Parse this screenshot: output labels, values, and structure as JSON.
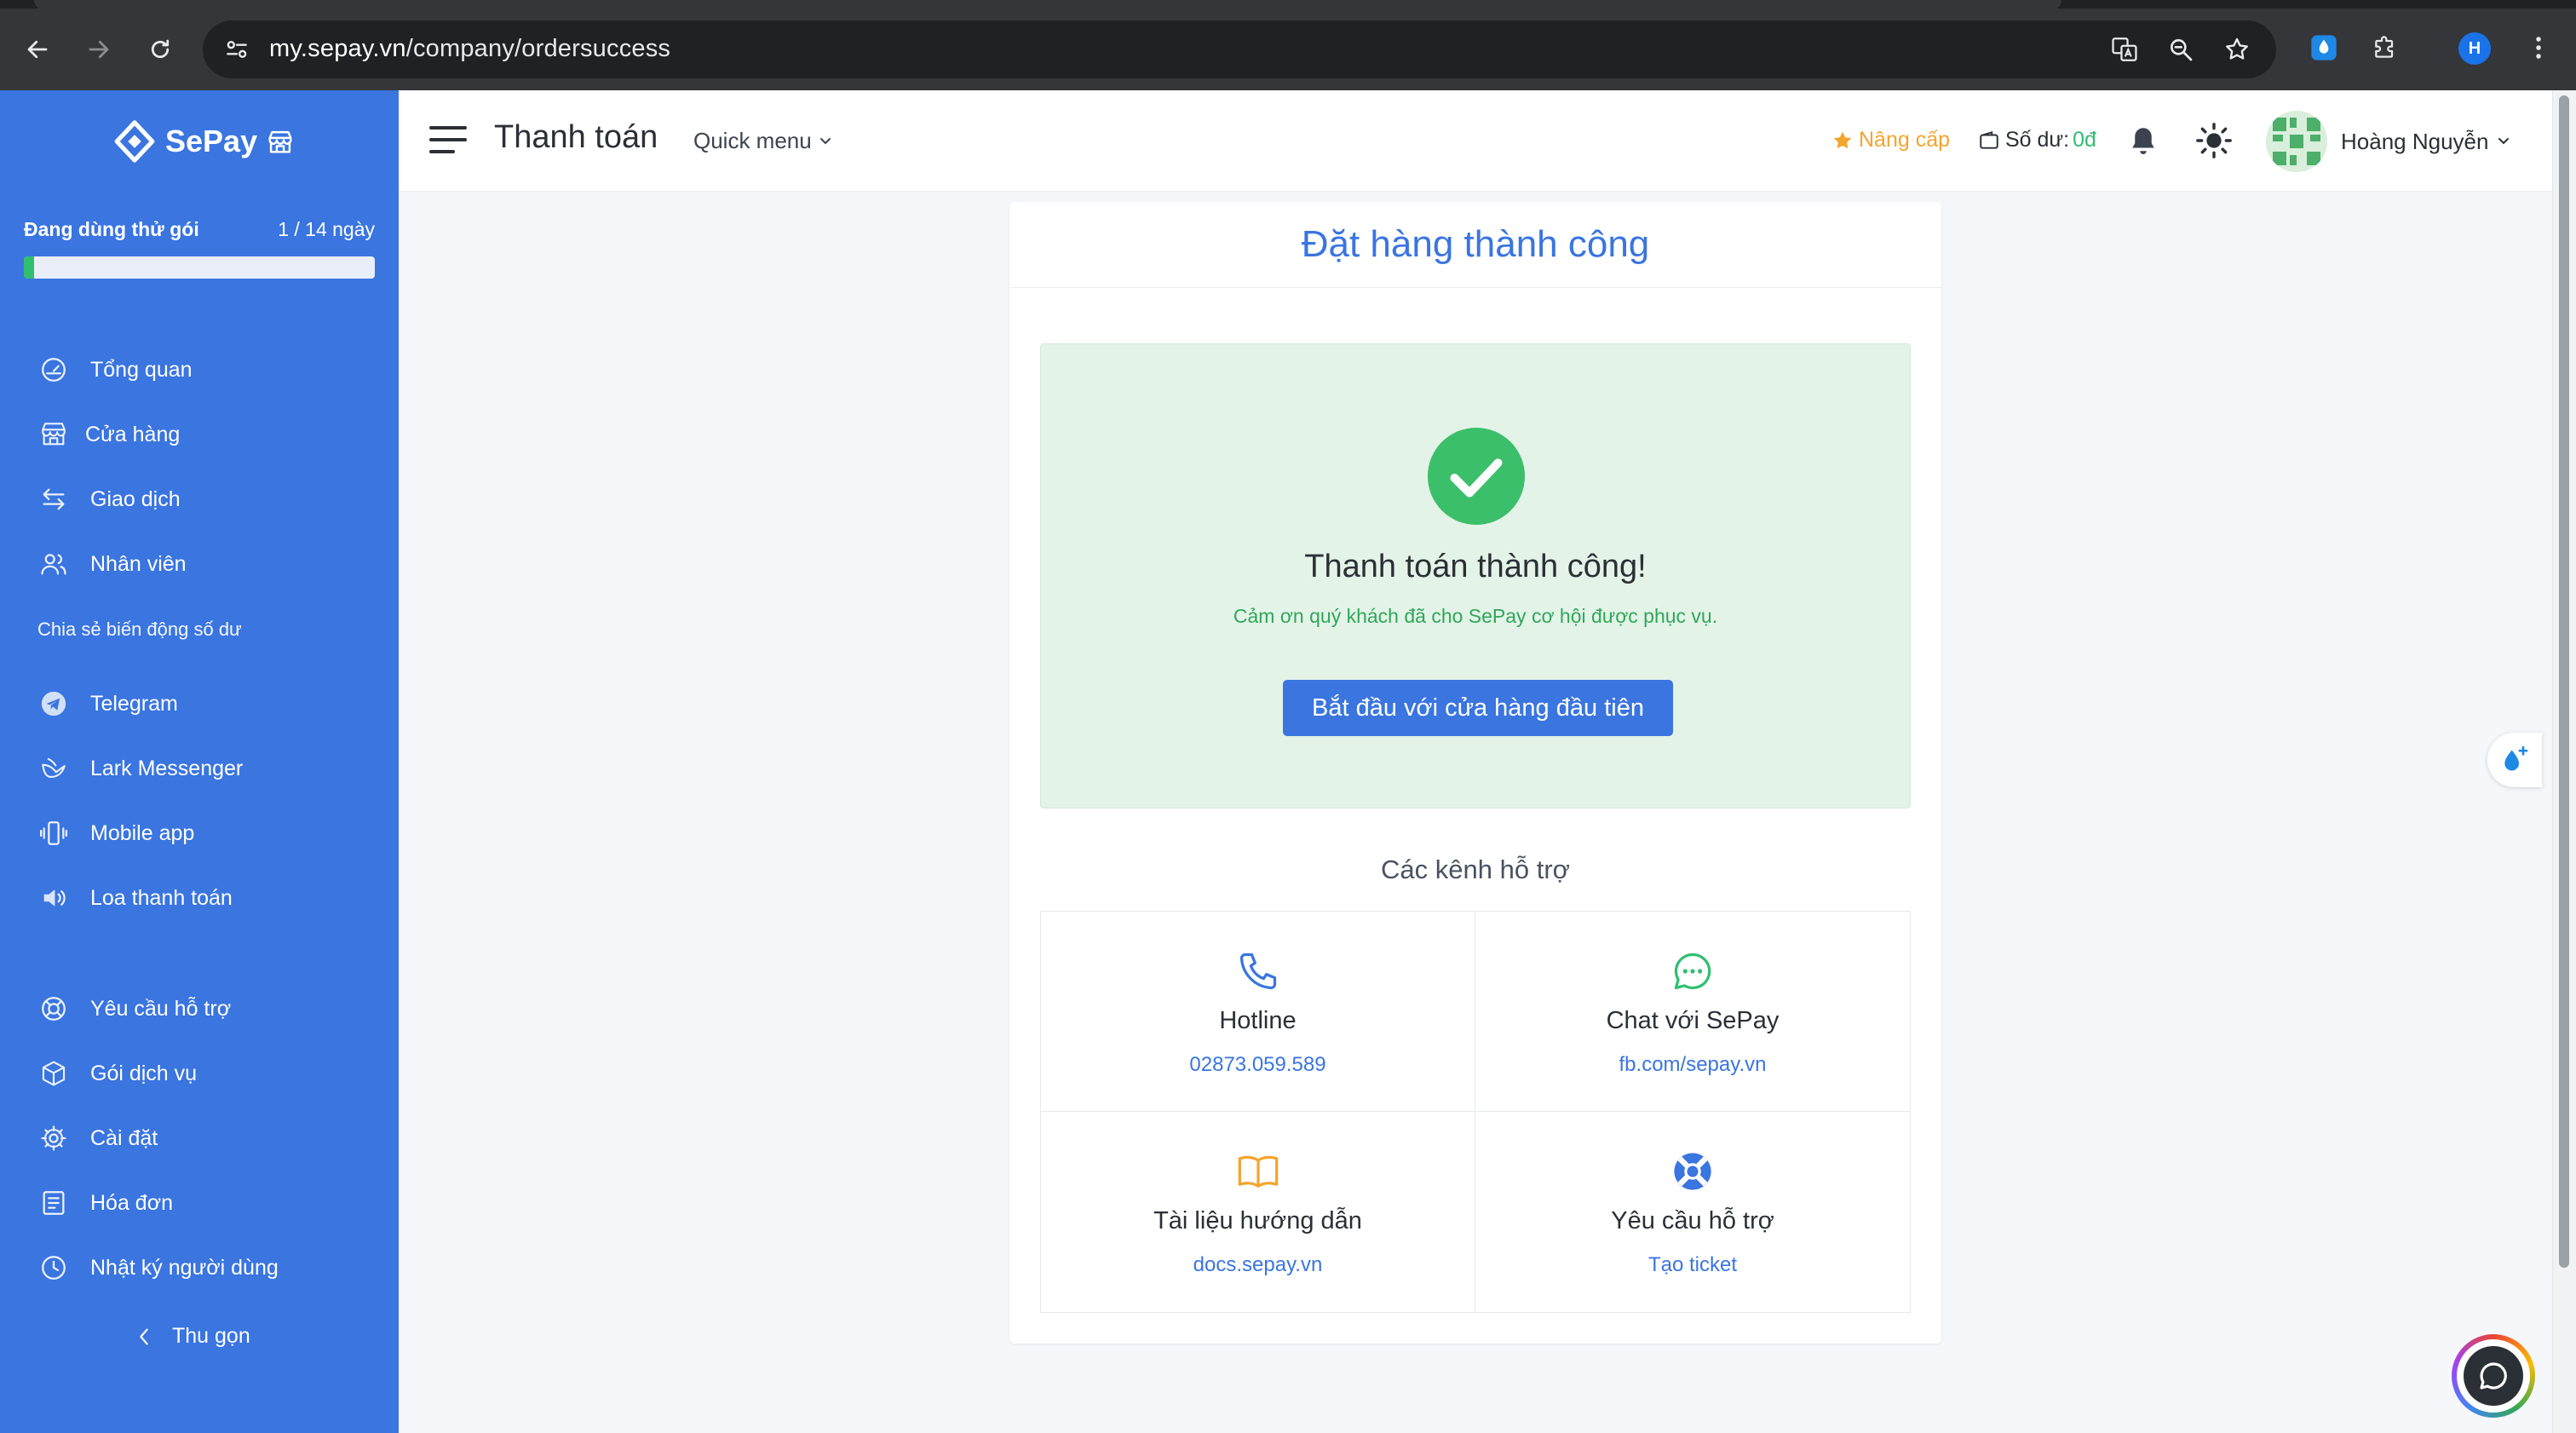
{
  "browser": {
    "url_host": "my.sepay.vn",
    "url_path": "/company/ordersuccess",
    "profile_initial": "H"
  },
  "sidebar": {
    "brand": "SePay",
    "trial": {
      "label": "Đang dùng thử gói",
      "days": "1 / 14 ngày",
      "progress_fraction": 0.03
    },
    "items_main": [
      {
        "label": "Tổng quan",
        "icon": "dashboard-gauge-icon"
      },
      {
        "label": "Cửa hàng",
        "icon": "store-icon"
      },
      {
        "label": "Giao dịch",
        "icon": "transfer-arrows-icon"
      },
      {
        "label": "Nhân viên",
        "icon": "users-icon"
      }
    ],
    "section_share": "Chia sẻ biến động số dư",
    "items_share": [
      {
        "label": "Telegram",
        "icon": "telegram-icon"
      },
      {
        "label": "Lark Messenger",
        "icon": "lark-icon"
      },
      {
        "label": "Mobile app",
        "icon": "mobile-vibrate-icon"
      },
      {
        "label": "Loa thanh toán",
        "icon": "speaker-icon"
      }
    ],
    "items_bottom": [
      {
        "label": "Yêu cầu hỗ trợ",
        "icon": "lifebuoy-icon"
      },
      {
        "label": "Gói dịch vụ",
        "icon": "package-box-icon"
      },
      {
        "label": "Cài đặt",
        "icon": "gear-icon"
      },
      {
        "label": "Hóa đơn",
        "icon": "invoice-icon"
      },
      {
        "label": "Nhật ký người dùng",
        "icon": "clock-icon"
      }
    ],
    "collapse": "Thu gọn"
  },
  "topbar": {
    "title": "Thanh toán",
    "quick_menu": "Quick menu",
    "upgrade": "Nâng cấp",
    "balance_label": "Số dư:",
    "balance_value": "0đ",
    "user_name": "Hoàng Nguyễn"
  },
  "order": {
    "header": "Đặt hàng thành công",
    "success_title": "Thanh toán thành công!",
    "success_message": "Cảm ơn quý khách đã cho SePay cơ hội được phục vụ.",
    "cta": "Bắt đầu với cửa hàng đầu tiên",
    "support_title": "Các kênh hỗ trợ",
    "channels": [
      {
        "label": "Hotline",
        "value": "02873.059.589",
        "icon": "phone-icon"
      },
      {
        "label": "Chat với SePay",
        "value": "fb.com/sepay.vn",
        "icon": "chat-bubble-icon"
      },
      {
        "label": "Tài liệu hướng dẫn",
        "value": "docs.sepay.vn",
        "icon": "book-icon"
      },
      {
        "label": "Yêu cầu hỗ trợ",
        "value": "Tạo ticket",
        "icon": "lifebuoy-icon"
      }
    ]
  },
  "colors": {
    "primary": "#3a75e0",
    "success": "#2fbf71",
    "success_bg": "#e3f3e7",
    "warning": "#f4a52d"
  }
}
